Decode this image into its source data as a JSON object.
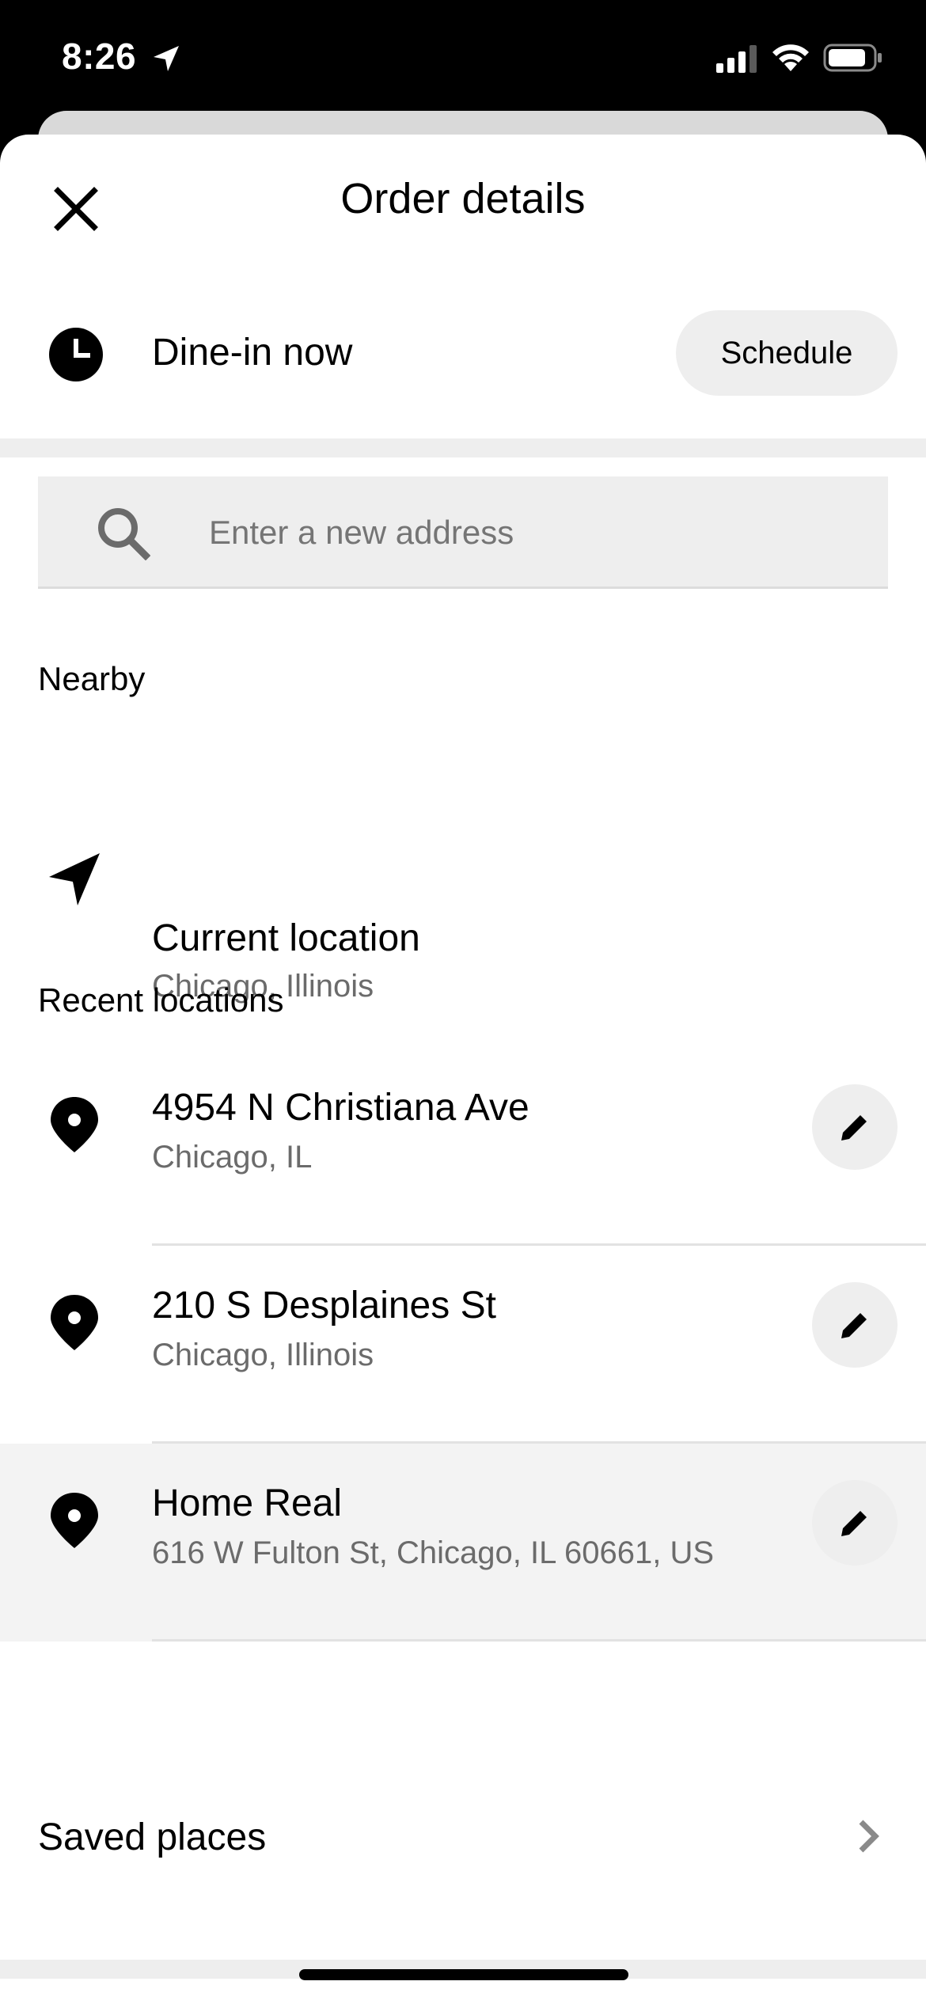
{
  "status_bar": {
    "time": "8:26"
  },
  "header": {
    "title": "Order details"
  },
  "dine": {
    "label": "Dine-in now",
    "schedule_label": "Schedule"
  },
  "search": {
    "placeholder": "Enter a new address",
    "value": ""
  },
  "nearby": {
    "heading": "Nearby",
    "current": {
      "title": "Current location",
      "subtitle": "Chicago, Illinois"
    }
  },
  "recent": {
    "heading": "Recent locations",
    "items": [
      {
        "title": "4954 N Christiana Ave",
        "subtitle": "Chicago, IL"
      },
      {
        "title": "210 S Desplaines St",
        "subtitle": "Chicago, Illinois"
      },
      {
        "title": "Home Real",
        "subtitle": "616 W Fulton St, Chicago, IL 60661, US"
      }
    ]
  },
  "saved": {
    "label": "Saved places"
  },
  "icons": {
    "close": "close-icon",
    "clock": "clock-icon",
    "search": "search-icon",
    "navigation": "navigation-arrow-icon",
    "pin": "location-pin-icon",
    "edit": "pencil-icon",
    "chevron": "chevron-right-icon"
  },
  "colors": {
    "background": "#ffffff",
    "status_bar": "#000000",
    "pill": "#eeeeee",
    "secondary_text": "#6b6b6b",
    "highlight_row": "#f3f3f3"
  }
}
